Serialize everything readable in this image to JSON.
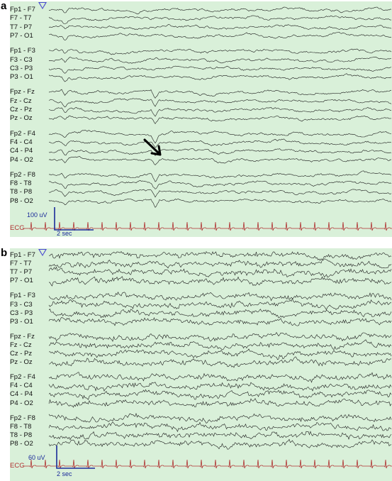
{
  "panels": [
    {
      "label": "a",
      "channels": [
        "Fp1 - F7",
        "F7 - T7",
        "T7 - P7",
        "P7 - O1",
        "Fp1 - F3",
        "F3 - C3",
        "C3 - P3",
        "P3 - O1",
        "Fpz - Fz",
        "Fz - Cz",
        "Cz - Pz",
        "Pz - Oz",
        "Fp2 - F4",
        "F4 - C4",
        "C4 - P4",
        "P4 - O2",
        "Fp2 - F8",
        "F8 - T8",
        "T8 - P8",
        "P8 - O2"
      ],
      "ecg_label": "ECG",
      "amplitude_scale": "100 uV",
      "time_scale": "2 sec",
      "annotation": "arrow"
    },
    {
      "label": "b",
      "channels": [
        "Fp1 - F7",
        "F7 - T7",
        "T7 - P7",
        "P7 - O1",
        "Fp1 - F3",
        "F3 - C3",
        "C3 - P3",
        "P3 - O1",
        "Fpz - Fz",
        "Fz - Cz",
        "Cz - Pz",
        "Pz - Oz",
        "Fp2 - F4",
        "F4 - C4",
        "C4 - P4",
        "P4 - O2",
        "Fp2 - F8",
        "F8 - T8",
        "T8 - P8",
        "P8 - O2"
      ],
      "ecg_label": "ECG",
      "amplitude_scale": "60 uV",
      "time_scale": "2 sec"
    }
  ],
  "colors": {
    "background": "#d9f0d9",
    "trace": "#1a1a1a",
    "ecg": "#b03030",
    "calibration": "#1a2a9a",
    "marker": "#4a4ad0"
  }
}
